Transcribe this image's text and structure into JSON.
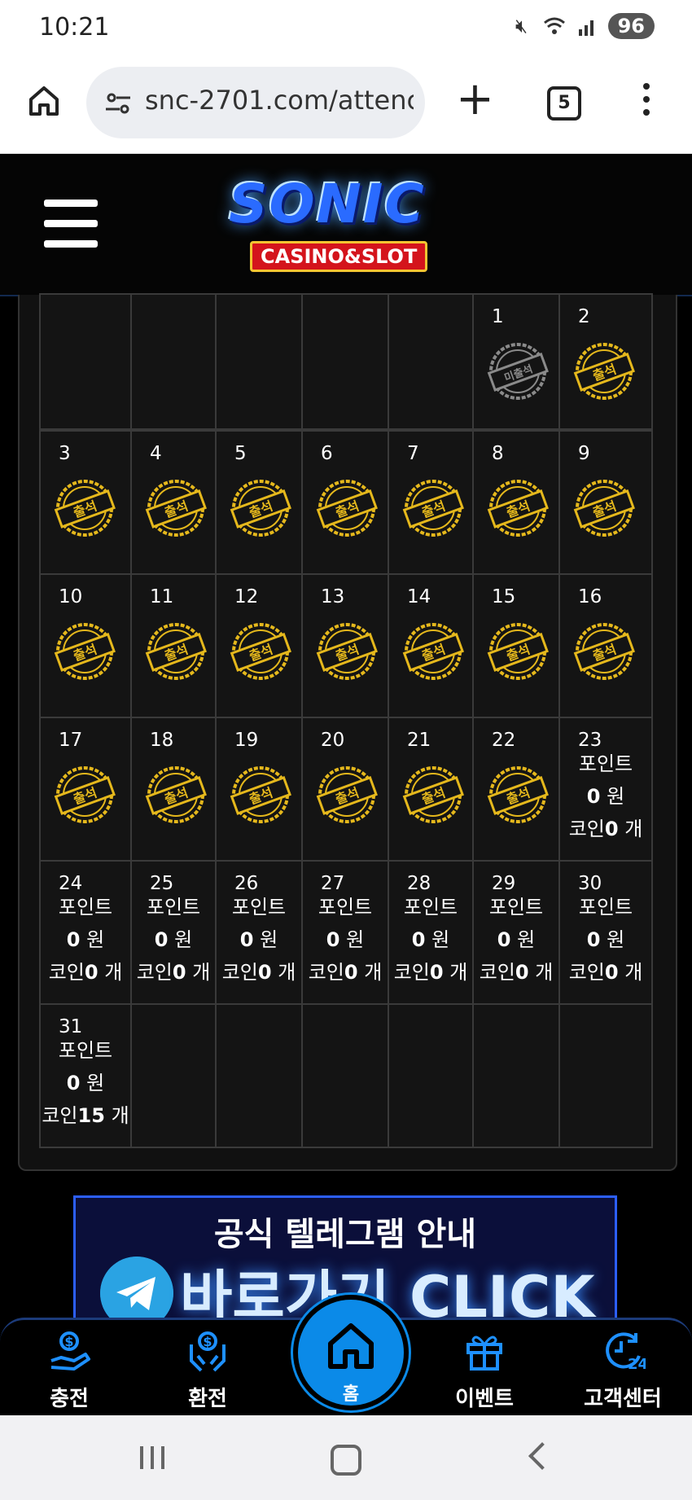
{
  "status_bar": {
    "time": "10:21",
    "battery": "96"
  },
  "browser": {
    "url": "snc-2701.com/attenc",
    "tab_count": "5"
  },
  "site": {
    "logo_main": "SONIC",
    "logo_sub": "CASINO&SLOT"
  },
  "calendar": {
    "stamp_present": "출석",
    "stamp_absent": "미출석",
    "points_label": "포인트",
    "won_unit": "원",
    "coin_label": "코인",
    "count_unit": "개",
    "days": [
      {
        "day": "1",
        "status": "absent"
      },
      {
        "day": "2",
        "status": "present"
      },
      {
        "day": "3",
        "status": "present"
      },
      {
        "day": "4",
        "status": "present"
      },
      {
        "day": "5",
        "status": "present"
      },
      {
        "day": "6",
        "status": "present"
      },
      {
        "day": "7",
        "status": "present"
      },
      {
        "day": "8",
        "status": "present"
      },
      {
        "day": "9",
        "status": "present"
      },
      {
        "day": "10",
        "status": "present"
      },
      {
        "day": "11",
        "status": "present"
      },
      {
        "day": "12",
        "status": "present"
      },
      {
        "day": "13",
        "status": "present"
      },
      {
        "day": "14",
        "status": "present"
      },
      {
        "day": "15",
        "status": "present"
      },
      {
        "day": "16",
        "status": "present"
      },
      {
        "day": "17",
        "status": "present"
      },
      {
        "day": "18",
        "status": "present"
      },
      {
        "day": "19",
        "status": "present"
      },
      {
        "day": "20",
        "status": "present"
      },
      {
        "day": "21",
        "status": "present"
      },
      {
        "day": "22",
        "status": "present"
      },
      {
        "day": "23",
        "status": "reward",
        "points": "0",
        "coins": "0"
      },
      {
        "day": "24",
        "status": "reward",
        "points": "0",
        "coins": "0"
      },
      {
        "day": "25",
        "status": "reward",
        "points": "0",
        "coins": "0"
      },
      {
        "day": "26",
        "status": "reward",
        "points": "0",
        "coins": "0"
      },
      {
        "day": "27",
        "status": "reward",
        "points": "0",
        "coins": "0"
      },
      {
        "day": "28",
        "status": "reward",
        "points": "0",
        "coins": "0"
      },
      {
        "day": "29",
        "status": "reward",
        "points": "0",
        "coins": "0"
      },
      {
        "day": "30",
        "status": "reward",
        "points": "0",
        "coins": "0"
      },
      {
        "day": "31",
        "status": "reward",
        "points": "0",
        "coins": "15"
      }
    ]
  },
  "banner": {
    "title": "공식 텔레그램 안내",
    "cta": "바로가기 CLICK"
  },
  "bottom_nav": {
    "charge": "충전",
    "exchange": "환전",
    "home": "홈",
    "event": "이벤트",
    "support": "고객센터"
  },
  "colors": {
    "accent": "#0b8ae8",
    "stamp_gold": "#e5b81c",
    "stamp_gray": "#8a8a8a"
  }
}
